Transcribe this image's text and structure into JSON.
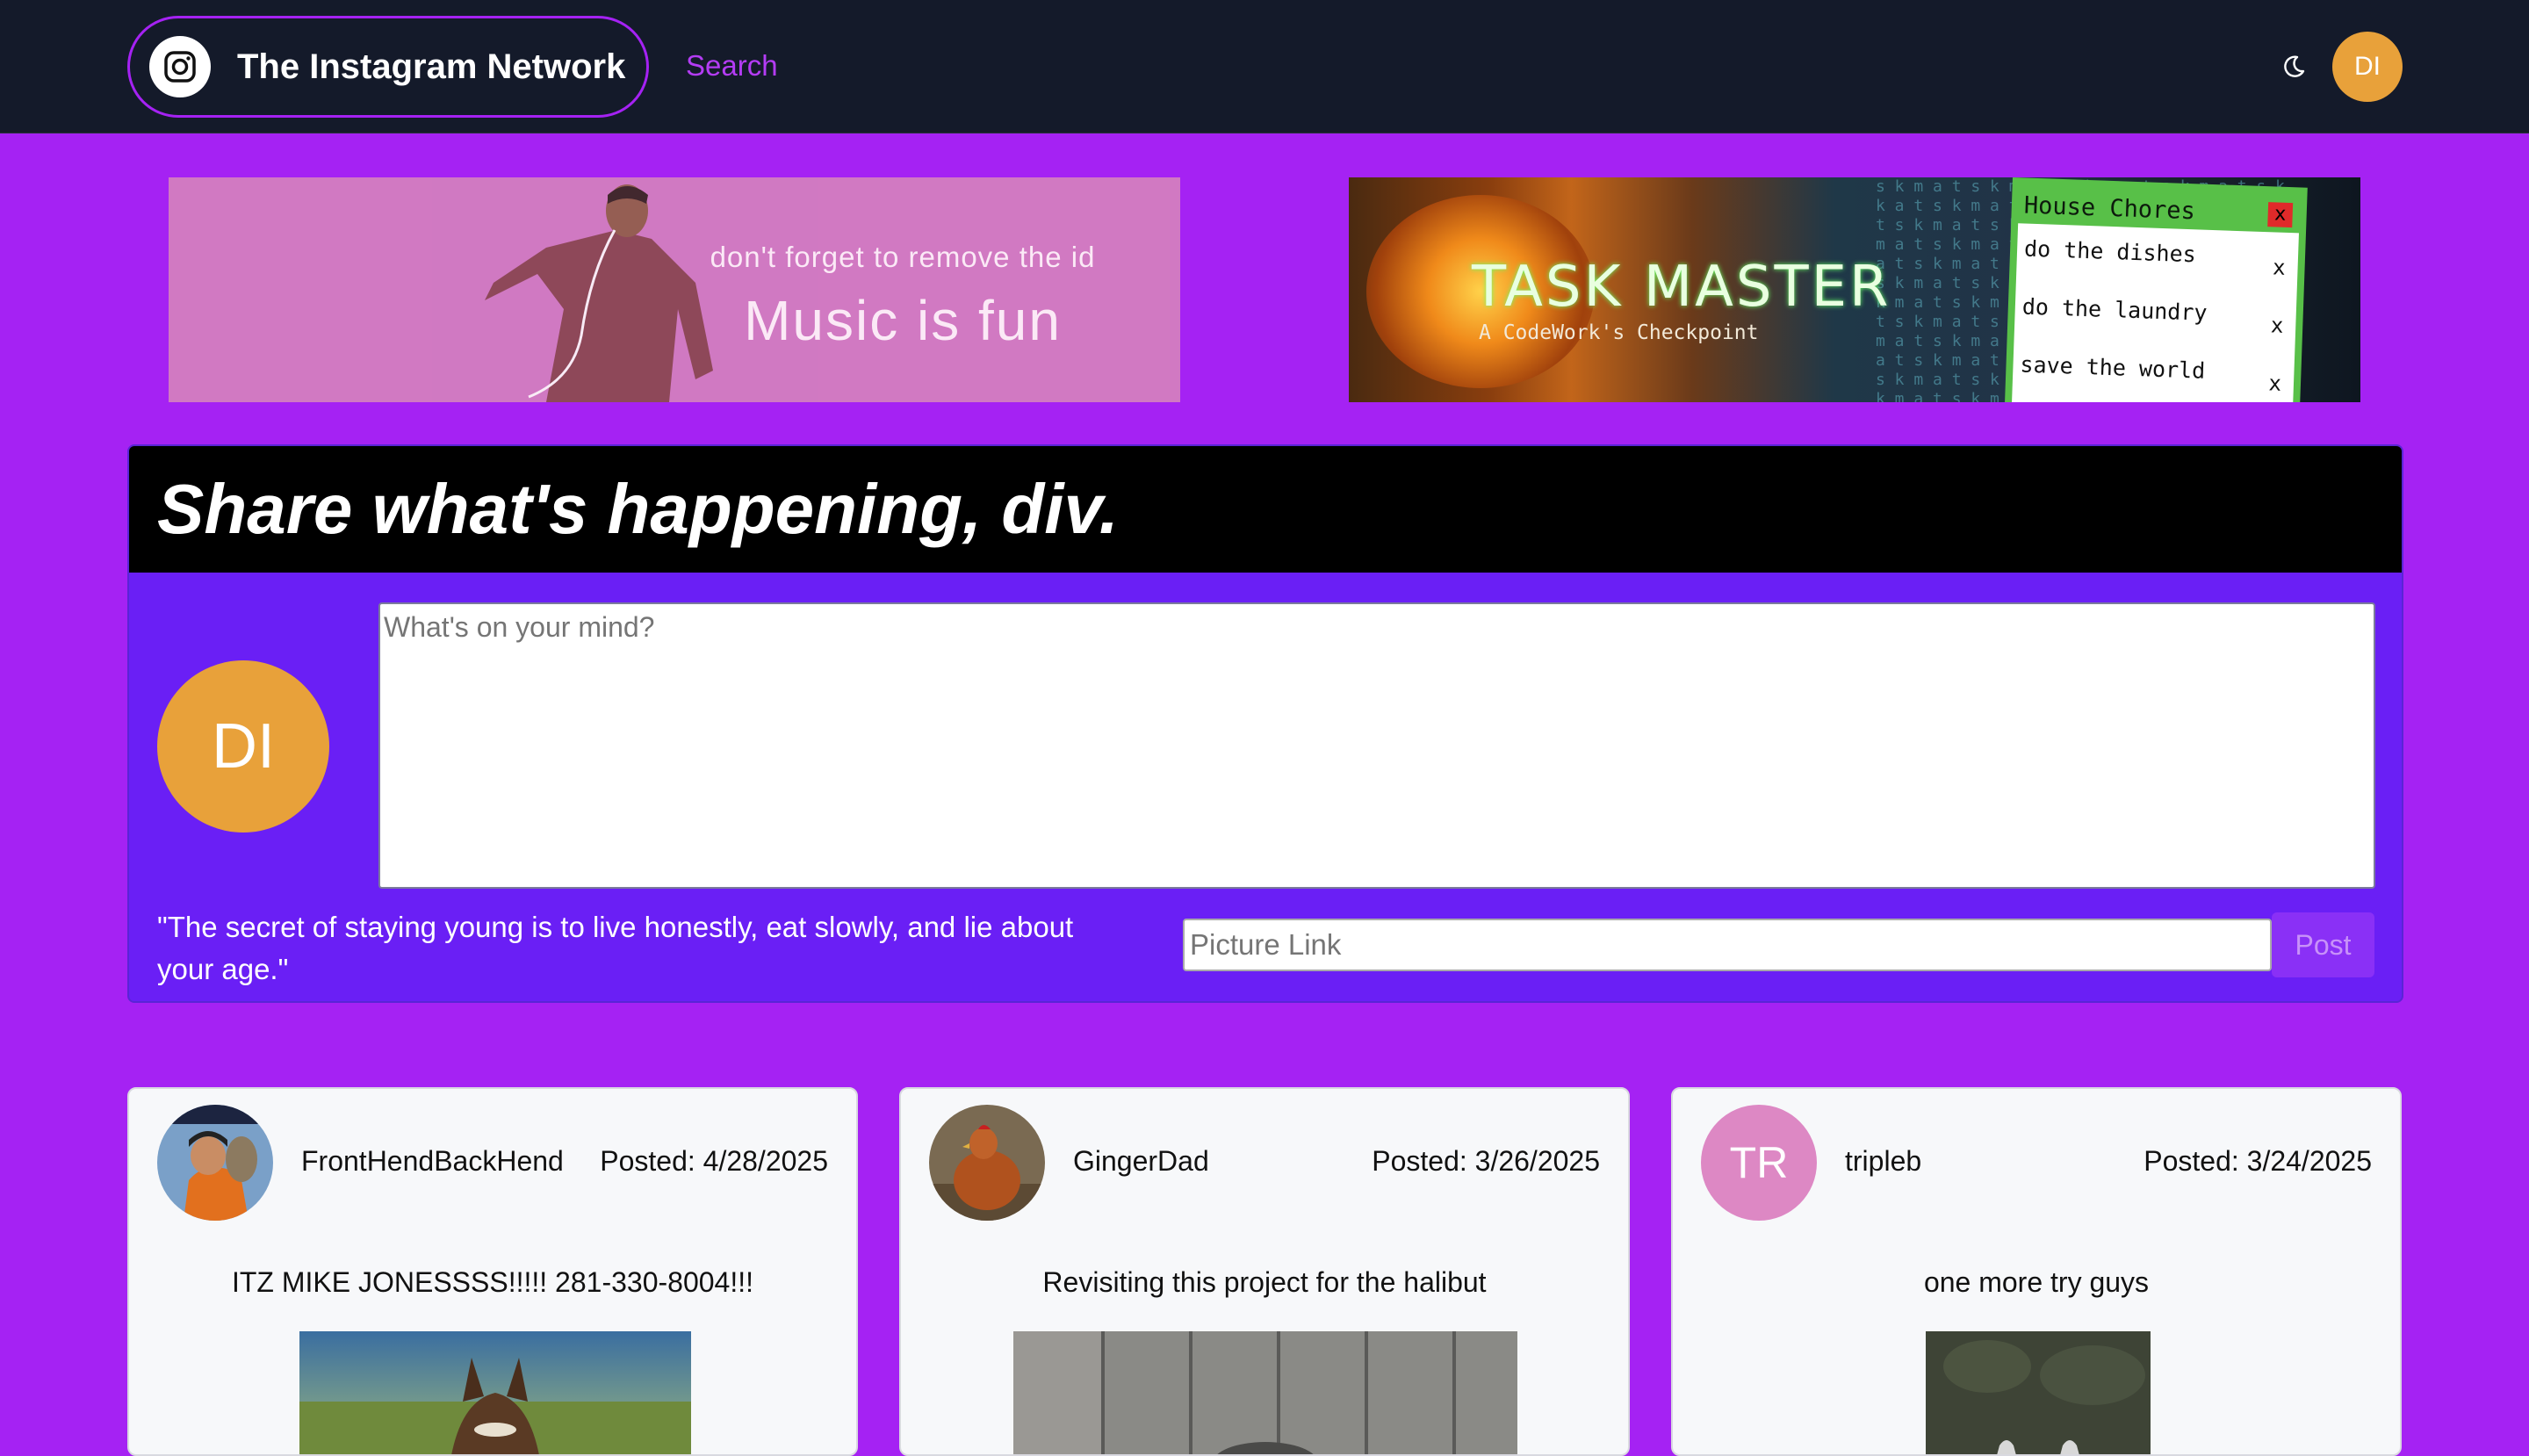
{
  "nav": {
    "brand_name": "The Instagram Network",
    "search_label": "Search",
    "avatar_initials": "DI"
  },
  "banners": {
    "music": {
      "subtitle": "don't forget to remove the id",
      "title": "Music is fun"
    },
    "task": {
      "title": "TASK MASTER",
      "subtitle": "A CodeWork's Checkpoint",
      "list_title": "House Chores",
      "close_label": "x",
      "items": [
        {
          "text": "do the dishes",
          "remove": "x"
        },
        {
          "text": "do the laundry",
          "remove": "x"
        },
        {
          "text": "save the world",
          "remove": "x"
        }
      ]
    }
  },
  "composer": {
    "title": "Share what's happening, div.",
    "avatar_initials": "DI",
    "textarea_placeholder": "What's on your mind?",
    "quote": "\"The secret of staying young is to live honestly, eat slowly, and lie about your age.\"",
    "picture_placeholder": "Picture Link",
    "post_label": "Post"
  },
  "posts": [
    {
      "username": "FrontHendBackHend",
      "date": "Posted: 4/28/2025",
      "text": "ITZ MIKE JONESSSS!!!!! 281-330-8004!!!"
    },
    {
      "username": "GingerDad",
      "date": "Posted: 3/26/2025",
      "text": "Revisiting this project for the halibut"
    },
    {
      "username": "tripleb",
      "date": "Posted: 3/24/2025",
      "text": "one more try guys",
      "avatar_initials": "TR"
    }
  ],
  "colors": {
    "page_bg": "#a522f3",
    "navbar_bg": "#141a2a",
    "composer_bg": "#6a1ff5",
    "avatar_orange": "#e8a13a",
    "avatar_pink": "#dd88c4",
    "accent_purple": "#b43cf5"
  }
}
